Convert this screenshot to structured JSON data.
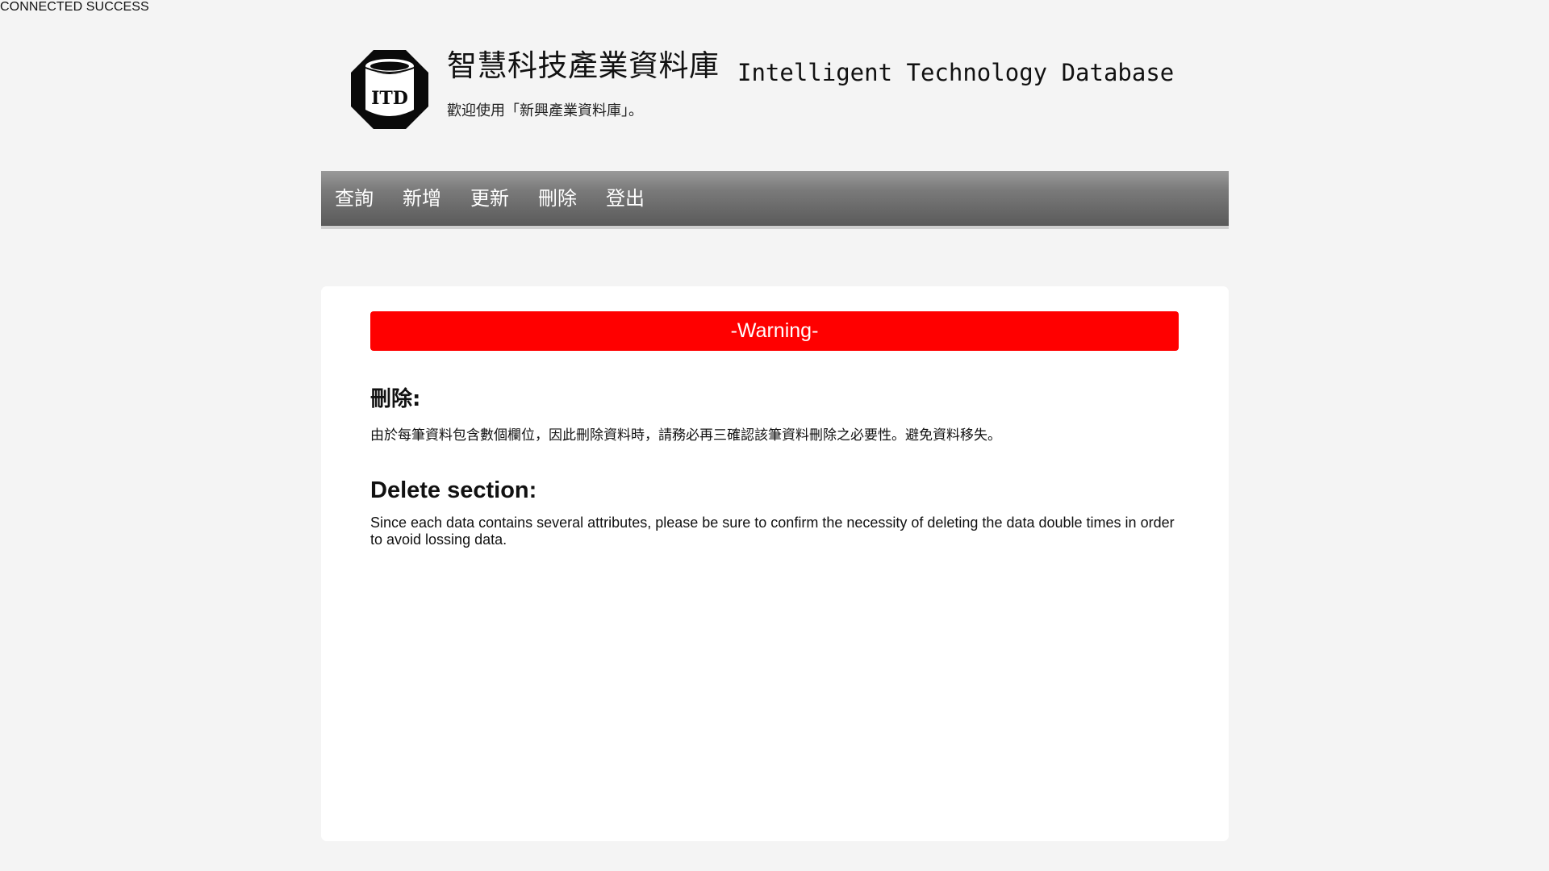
{
  "status": {
    "text": "CONNECTED SUCCESS"
  },
  "header": {
    "logo_text": "ITD",
    "title_zh": "智慧科技產業資料庫",
    "title_en": "Intelligent Technology Database",
    "welcome": "歡迎使用「新興產業資料庫」。"
  },
  "nav": {
    "items": [
      {
        "label": "查詢",
        "icon": "none"
      },
      {
        "label": "新增",
        "icon": "none"
      },
      {
        "label": "更新",
        "icon": "none"
      },
      {
        "label": "刪除",
        "icon": "none"
      },
      {
        "label": "登出",
        "icon": "none"
      }
    ]
  },
  "content": {
    "warning": "-Warning-",
    "zh_heading": "刪除:",
    "zh_text": "由於每筆資料包含數個欄位，因此刪除資料時，請務必再三確認該筆資料刪除之必要性。避免資料移失。",
    "en_heading": "Delete section:",
    "en_text": "Since each data contains several attributes, please be sure to confirm the necessity of deleting the data double times in order to avoid lossing data."
  },
  "colors": {
    "warning_bg": "#ff0000",
    "navbar_top": "#9a9a9a",
    "navbar_bottom": "#5a5a5a",
    "page_bg": "#f4f4f4",
    "panel_bg": "#ffffff"
  }
}
